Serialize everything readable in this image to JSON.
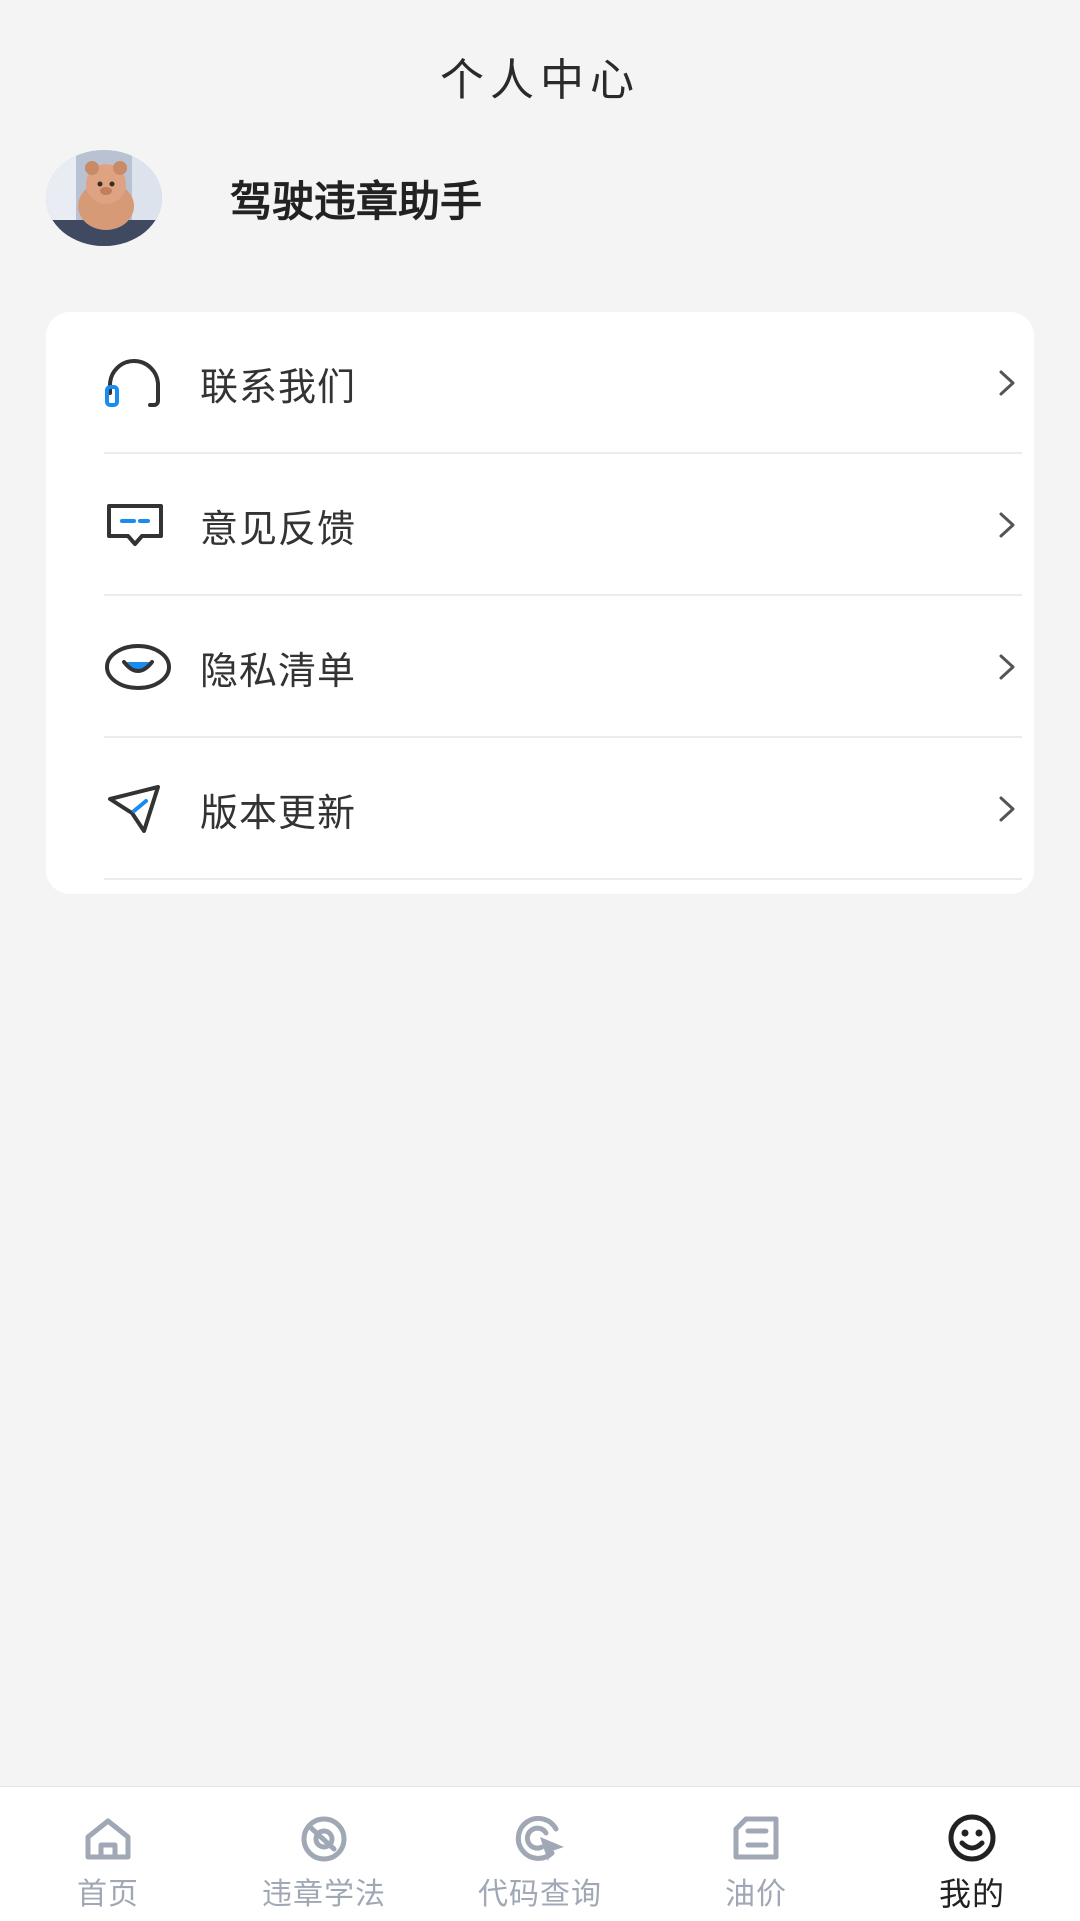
{
  "header": {
    "title": "个人中心"
  },
  "profile": {
    "name": "驾驶违章助手"
  },
  "menu": {
    "items": [
      {
        "label": "联系我们",
        "icon": "headset-icon"
      },
      {
        "label": "意见反馈",
        "icon": "feedback-icon"
      },
      {
        "label": "隐私清单",
        "icon": "privacy-eye-icon"
      },
      {
        "label": "版本更新",
        "icon": "paper-plane-icon"
      }
    ]
  },
  "tabbar": {
    "tabs": [
      {
        "label": "首页",
        "icon": "home-icon",
        "active": false
      },
      {
        "label": "违章学法",
        "icon": "study-icon",
        "active": false
      },
      {
        "label": "代码查询",
        "icon": "search-code-icon",
        "active": false
      },
      {
        "label": "油价",
        "icon": "fuel-price-icon",
        "active": false
      },
      {
        "label": "我的",
        "icon": "profile-smile-icon",
        "active": true
      }
    ]
  },
  "colors": {
    "accent": "#1a8cf0",
    "tab_inactive": "#a0a8b6",
    "background": "#f4f4f5"
  }
}
